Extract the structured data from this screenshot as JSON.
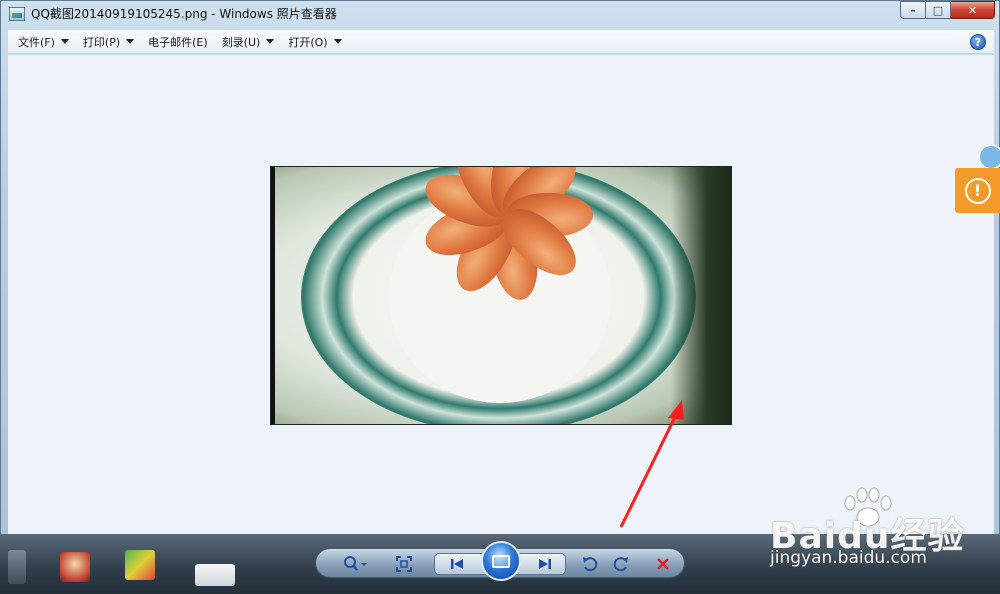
{
  "window": {
    "title": "QQ截图20140919105245.png - Windows 照片查看器",
    "minimize_glyph": "–",
    "maximize_glyph": "□",
    "close_glyph": "✕"
  },
  "menu": {
    "items": [
      {
        "label": "文件(F)",
        "has_dropdown": true
      },
      {
        "label": "打印(P)",
        "has_dropdown": true
      },
      {
        "label": "电子邮件(E)",
        "has_dropdown": false
      },
      {
        "label": "刻录(U)",
        "has_dropdown": true
      },
      {
        "label": "打开(O)",
        "has_dropdown": true
      }
    ],
    "help_glyph": "?"
  },
  "viewer": {
    "background_color": "#eef2f9"
  },
  "controls": {
    "zoom_icon": "magnifier-icon",
    "fit_icon": "actual-size-icon",
    "prev_icon": "previous-icon",
    "slideshow_icon": "slideshow-icon",
    "next_icon": "next-icon",
    "rotate_left_icon": "rotate-counterclockwise-icon",
    "rotate_right_icon": "rotate-clockwise-icon",
    "delete_icon": "delete-icon"
  },
  "side_widget": {
    "icon": "warning-icon",
    "glyph": "!",
    "color": "#f39a2a"
  },
  "annotation": {
    "arrow_color": "#ff1e1e"
  },
  "watermark": {
    "brand": "Baidu经验",
    "url": "jingyan.baidu.com"
  }
}
